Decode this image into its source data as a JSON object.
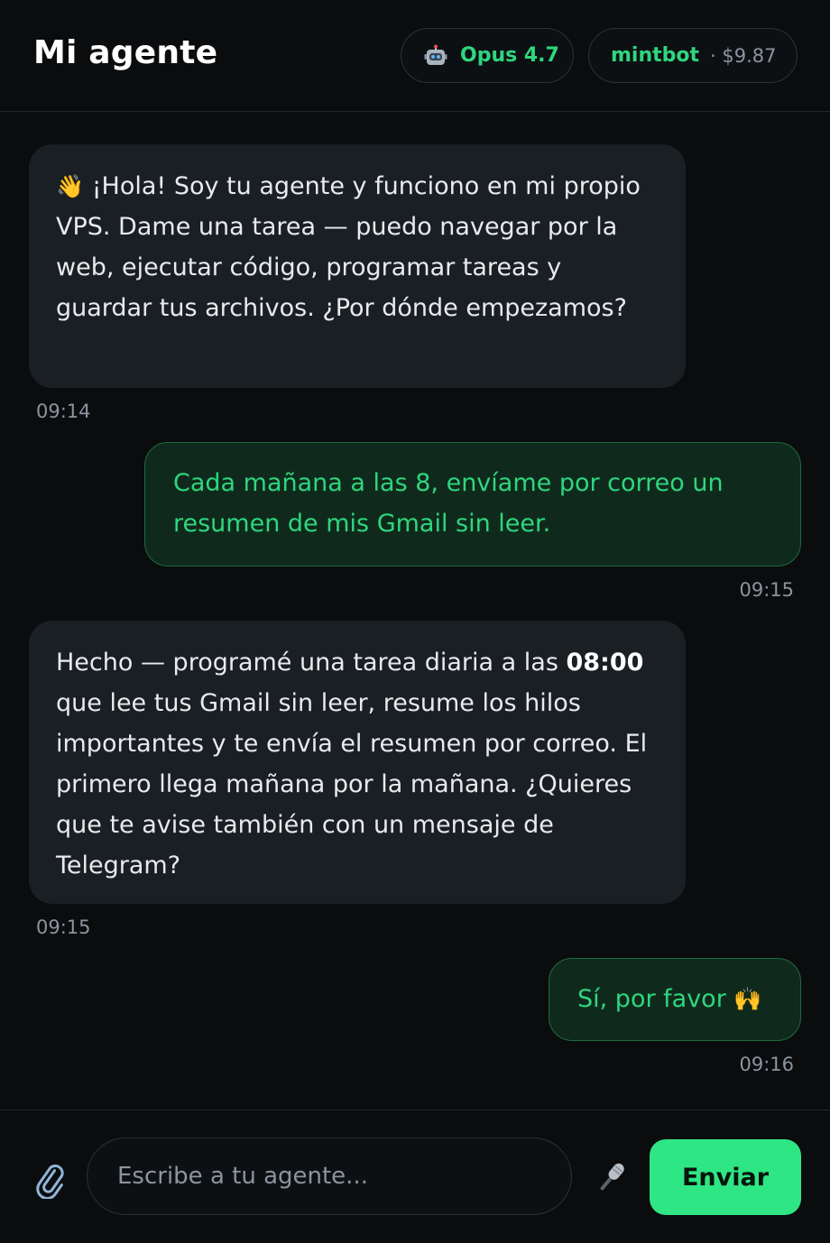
{
  "header": {
    "title": "Mi agente",
    "model_label": "Opus 4.7",
    "user_name": "mintbot",
    "user_cost": "· $9.87"
  },
  "messages": [
    {
      "role": "bot",
      "emoji": "👋",
      "text": " ¡Hola! Soy tu agente y funciono en mi propio VPS. Dame una tarea — puedo navegar por la web, ejecutar código, programar tareas y guardar tus archivos. ¿Por dónde empezamos?",
      "time": "09:14"
    },
    {
      "role": "user",
      "text": "Cada mañana a las 8, envíame por correo un resumen de mis Gmail sin leer.",
      "time": "09:15"
    },
    {
      "role": "bot",
      "text_before": "Hecho — programé una tarea diaria a las ",
      "text_bold": "08:00",
      "text_after": " que lee tus Gmail sin leer, resume los hilos importantes y te envía el resumen por correo. El primero llega mañana por la mañana. ¿Quieres que te avise también con un mensaje de Telegram?",
      "time": "09:15"
    },
    {
      "role": "user",
      "text": "Sí, por favor ",
      "emoji": "🙌",
      "time": "09:16"
    }
  ],
  "composer": {
    "placeholder": "Escribe a tu agente...",
    "value": "",
    "send_label": "Enviar"
  },
  "icons": {
    "model": "robot-icon",
    "attach": "paperclip-icon",
    "mic": "microphone-icon"
  },
  "colors": {
    "accent": "#2fd67e",
    "send_button": "#2ee684",
    "background": "#0a0c0e",
    "bot_bubble": "#1a1f24",
    "user_bubble": "#0f2a1c"
  }
}
